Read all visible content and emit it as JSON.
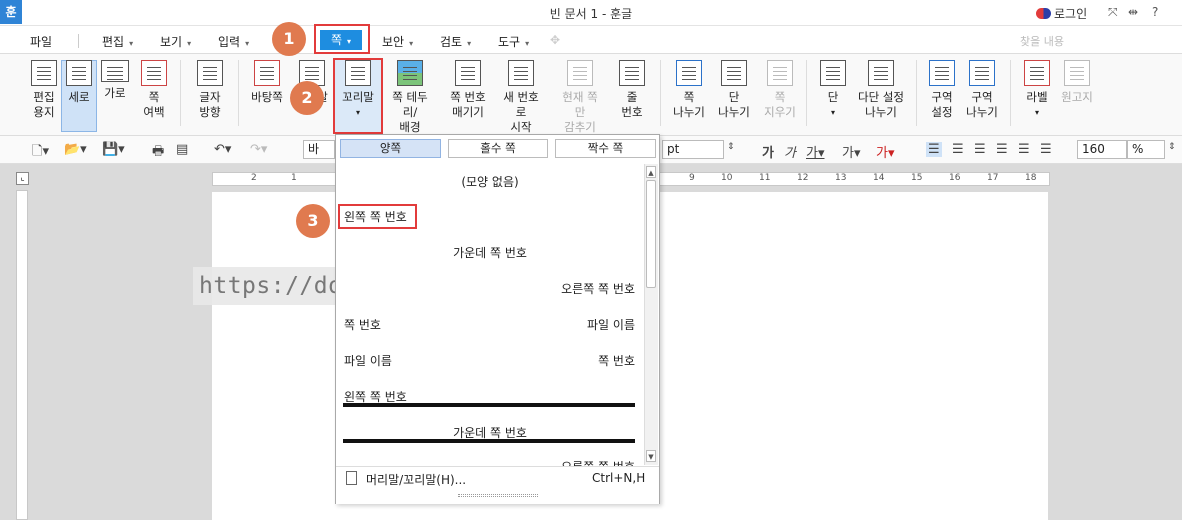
{
  "titlebar": {
    "app_icon": "훈",
    "title": "빈 문서 1 - 훈글",
    "login": "로그인",
    "win_buttons": [
      "⤧",
      "⇹",
      "?"
    ]
  },
  "menubar": {
    "items": [
      "파일",
      "편집",
      "보기",
      "입력",
      "쪽",
      "보안",
      "검토",
      "도구"
    ],
    "find_placeholder": "찾을 내용"
  },
  "ribbon": {
    "buttons": [
      {
        "label": "편집\n용지"
      },
      {
        "label": "세로"
      },
      {
        "label": "가로"
      },
      {
        "label": "쪽\n여백"
      },
      {
        "label": "글자\n방향"
      },
      {
        "label": "바탕쪽"
      },
      {
        "label": "머리말"
      },
      {
        "label": "꼬리말"
      },
      {
        "label": "쪽 테두리/\n배경"
      },
      {
        "label": "쪽 번호\n매기기"
      },
      {
        "label": "새 번호로\n시작"
      },
      {
        "label": "현재 쪽만\n감추기"
      },
      {
        "label": "줄\n번호"
      },
      {
        "label": "쪽\n나누기"
      },
      {
        "label": "단\n나누기"
      },
      {
        "label": "쪽\n지우기"
      },
      {
        "label": "단"
      },
      {
        "label": "다단 설정\n나누기"
      },
      {
        "label": "구역\n설정"
      },
      {
        "label": "구역\n나누기"
      },
      {
        "label": "라벨"
      },
      {
        "label": "원고지"
      }
    ]
  },
  "toolbar": {
    "style_value": "바",
    "unit": "pt",
    "zoom": "160",
    "zoom_unit": "%"
  },
  "dropdown": {
    "tabs": [
      "양쪽",
      "홀수 쪽",
      "짝수 쪽"
    ],
    "options": {
      "none": "(모양 없음)",
      "left_page_num": "왼쪽 쪽 번호",
      "center_page_num": "가운데 쪽 번호",
      "right_page_num": "오른쪽 쪽 번호",
      "page_num": "쪽 번호",
      "file_name": "파일 이름",
      "file_name_2": "파일 이름",
      "page_num_2": "쪽 번호",
      "left_page_num_line": "왼쪽 쪽 번호",
      "center_page_num_line": "가운데 쪽 번호",
      "right_page_num_partial": "오른쪽 쪽 번호"
    },
    "footer_label": "머리말/꼬리말(H)...",
    "footer_shortcut": "Ctrl+N,H"
  },
  "watermark": "https://dolpali.tistory.com",
  "annotations": {
    "step1": "1",
    "step2": "2",
    "step3": "3"
  },
  "ruler": {
    "ticks": [
      "2",
      "1",
      "9",
      "10",
      "11",
      "12",
      "13",
      "14",
      "15",
      "16",
      "17",
      "18"
    ]
  },
  "colors": {
    "accent": "#1e8de0",
    "highlight": "#e23b3b",
    "badge": "#e07a4f"
  }
}
